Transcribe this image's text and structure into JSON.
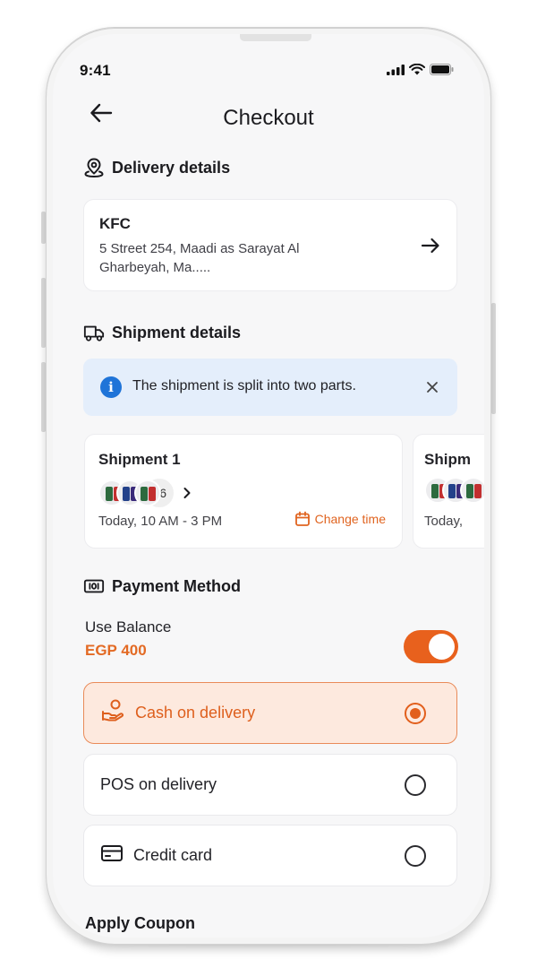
{
  "status_bar": {
    "time": "9:41"
  },
  "header": {
    "title": "Checkout"
  },
  "delivery": {
    "heading": "Delivery details",
    "name": "KFC",
    "address": "5 Street 254, Maadi as Sarayat Al Gharbeyah, Ma....."
  },
  "shipment": {
    "heading": "Shipment details",
    "notice": "The shipment is split into two parts.",
    "shipments": [
      {
        "title": "Shipment 1",
        "more_count": "+6",
        "time": "Today, 10 AM - 3 PM",
        "change_label": "Change time"
      },
      {
        "title": "Shipm",
        "time": "Today,"
      }
    ]
  },
  "payment": {
    "heading": "Payment Method",
    "balance_label": "Use Balance",
    "balance_value": "EGP 400",
    "use_balance": true,
    "options": [
      {
        "label": "Cash on delivery",
        "icon": "cash-hand-icon",
        "selected": true
      },
      {
        "label": "POS on delivery",
        "selected": false
      },
      {
        "label": "Credit card",
        "icon": "credit-card-icon",
        "selected": false
      }
    ]
  },
  "coupon": {
    "heading": "Apply Coupon"
  },
  "colors": {
    "accent": "#E8611D",
    "info_bg": "#E4EEFB",
    "info_icon": "#1F74D8",
    "selected_bg": "#FDE9DE"
  }
}
